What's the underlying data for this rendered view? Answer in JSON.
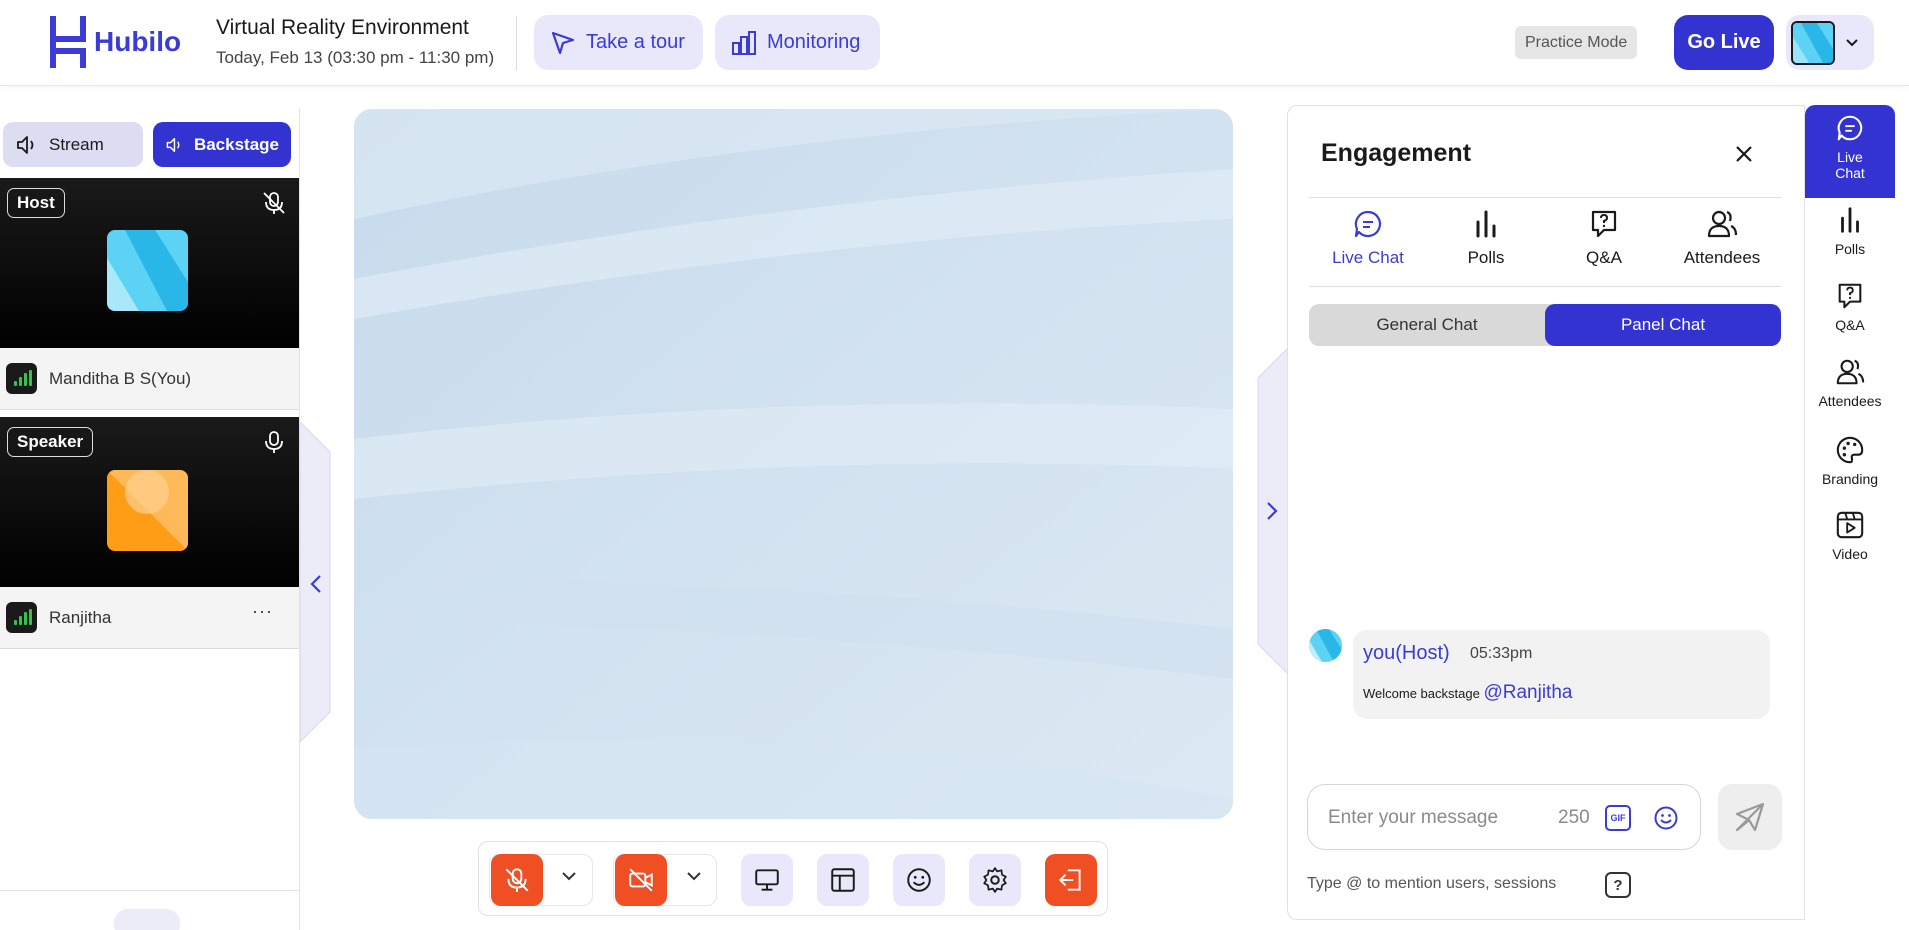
{
  "app": {
    "brand": "Hubilo",
    "event_title": "Virtual Reality Environment",
    "event_date": "Today, Feb 13 (03:30 pm - 11:30 pm)"
  },
  "header": {
    "tour_label": "Take a tour",
    "monitoring_label": "Monitoring",
    "practice_mode": "Practice Mode",
    "go_live": "Go Live"
  },
  "left_panel": {
    "stream_label": "Stream",
    "backstage_label": "Backstage",
    "participants": [
      {
        "role": "Host",
        "name": "Manditha B S(You)",
        "mic": "muted"
      },
      {
        "role": "Speaker",
        "name": "Ranjitha",
        "mic": "on",
        "more": "···"
      }
    ]
  },
  "engagement": {
    "title": "Engagement",
    "tabs": [
      {
        "label": "Live Chat",
        "icon": "chat-icon",
        "active": true
      },
      {
        "label": "Polls",
        "icon": "polls-icon"
      },
      {
        "label": "Q&A",
        "icon": "qa-icon"
      },
      {
        "label": "Attendees",
        "icon": "attendees-icon"
      }
    ],
    "chat_modes": [
      {
        "label": "General Chat",
        "active": false
      },
      {
        "label": "Panel Chat",
        "active": true
      }
    ],
    "messages": [
      {
        "author": "you(Host)",
        "time": "05:33pm",
        "text": "Welcome backstage",
        "mention": "@Ranjitha"
      }
    ],
    "input": {
      "placeholder": "Enter your message",
      "char_count": "250",
      "gif": "GIF"
    },
    "hint": "Type @ to mention users, sessions",
    "help": "?"
  },
  "rail": {
    "items": [
      {
        "label": "Live Chat",
        "icon": "chat-icon",
        "active": true
      },
      {
        "label": "Polls",
        "icon": "polls-icon"
      },
      {
        "label": "Q&A",
        "icon": "qa-icon"
      },
      {
        "label": "Attendees",
        "icon": "attendees-icon"
      },
      {
        "label": "Branding",
        "icon": "palette-icon"
      },
      {
        "label": "Video",
        "icon": "video-icon"
      }
    ]
  },
  "colors": {
    "accent": "#3333d1",
    "accent_soft": "#e8e8fa",
    "danger": "#f04e23",
    "signal": "#39c24a"
  }
}
